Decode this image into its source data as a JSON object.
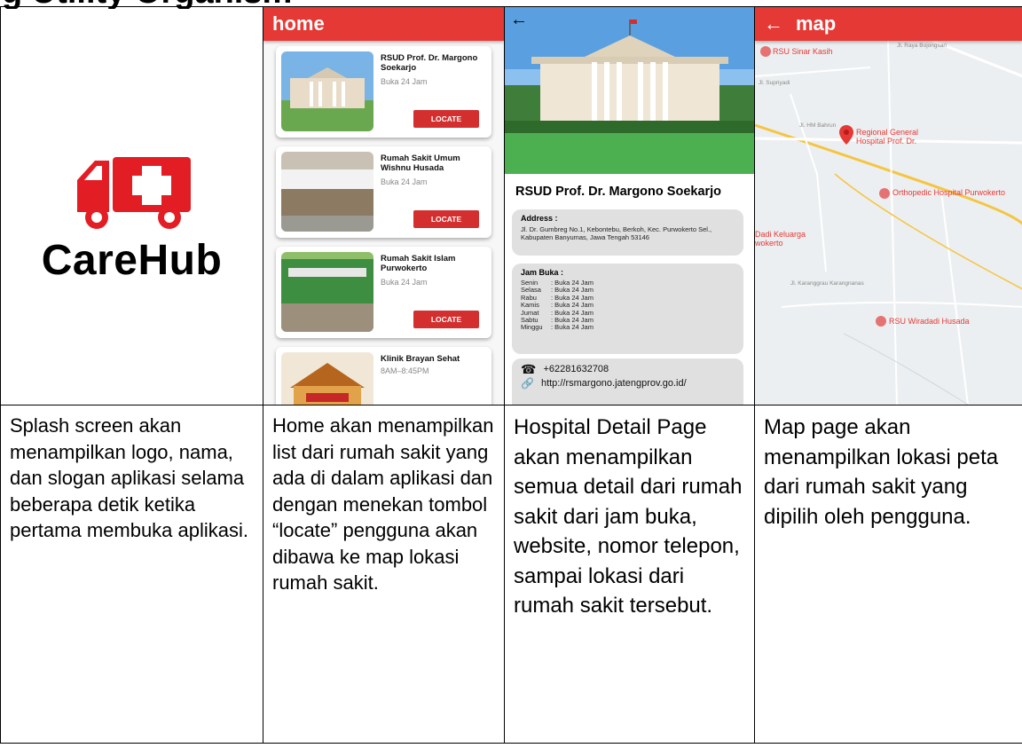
{
  "heading": "g Utility Organism",
  "splash": {
    "app_name": "CareHub",
    "accent": "#e31d24"
  },
  "home": {
    "appbar_title": "home",
    "locate_label": "LOCATE",
    "items": [
      {
        "name": "RSUD Prof. Dr. Margono Soekarjo",
        "hours": "Buka 24 Jam",
        "has_button": true
      },
      {
        "name": "Rumah Sakit Umum Wishnu Husada",
        "hours": "Buka 24 Jam",
        "has_button": true
      },
      {
        "name": "Rumah Sakit Islam Purwokerto",
        "hours": "Buka 24 Jam",
        "has_button": true
      },
      {
        "name": "Klinik Brayan Sehat",
        "hours": "8AM–8:45PM",
        "has_button": false
      }
    ]
  },
  "detail": {
    "name": "RSUD Prof. Dr. Margono Soekarjo",
    "address_label": "Address :",
    "address": "Jl. Dr. Gumbreg No.1, Kebontebu, Berkoh, Kec. Purwokerto Sel., Kabupaten Banyumas, Jawa Tengah 53146",
    "hours_label": "Jam Buka :",
    "schedule": [
      {
        "day": "Senin",
        "hours": ": Buka 24 Jam"
      },
      {
        "day": "Selasa",
        "hours": ": Buka 24 Jam"
      },
      {
        "day": "Rabu",
        "hours": ": Buka 24 Jam"
      },
      {
        "day": "Kamis",
        "hours": ": Buka 24 Jam"
      },
      {
        "day": "Jumat",
        "hours": ": Buka 24 Jam"
      },
      {
        "day": "Sabtu",
        "hours": ": Buka 24 Jam"
      },
      {
        "day": "Minggu",
        "hours": ": Buka 24 Jam"
      }
    ],
    "phone": "+62281632708",
    "website": "http://rsmargono.jatengprov.go.id/"
  },
  "map": {
    "appbar_title": "map",
    "labels": {
      "sinar_kasih": "RSU Sinar Kasih",
      "regional": "Regional General Hospital Prof. Dr.",
      "orthopedic": "Orthopedic Hospital Purwokerto",
      "dadi": "Dadi Keluarga wokerto",
      "wiradadi": "RSU Wiradadi Husada"
    },
    "streets": {
      "bojongsari": "Jl. Raya Bojongsari",
      "supriyadi": "Jl. Supriyadi",
      "karangnanas": "Jl. Karanggrau Karangnanas",
      "bahrun": "Jl. HM Bahrun"
    }
  },
  "captions": [
    "Splash screen akan menampilkan logo, nama, dan slogan aplikasi selama beberapa detik ketika pertama membuka aplikasi.",
    "Home akan menampilkan list dari rumah sakit yang ada di dalam aplikasi dan dengan menekan tombol “locate” pengguna akan dibawa ke map lokasi rumah sakit.",
    "Hospital Detail Page akan menampilkan semua detail dari rumah sakit dari jam buka, website, nomor telepon, sampai lokasi dari rumah sakit tersebut.",
    "Map page akan menampilkan lokasi peta dari rumah sakit yang dipilih oleh pengguna."
  ]
}
